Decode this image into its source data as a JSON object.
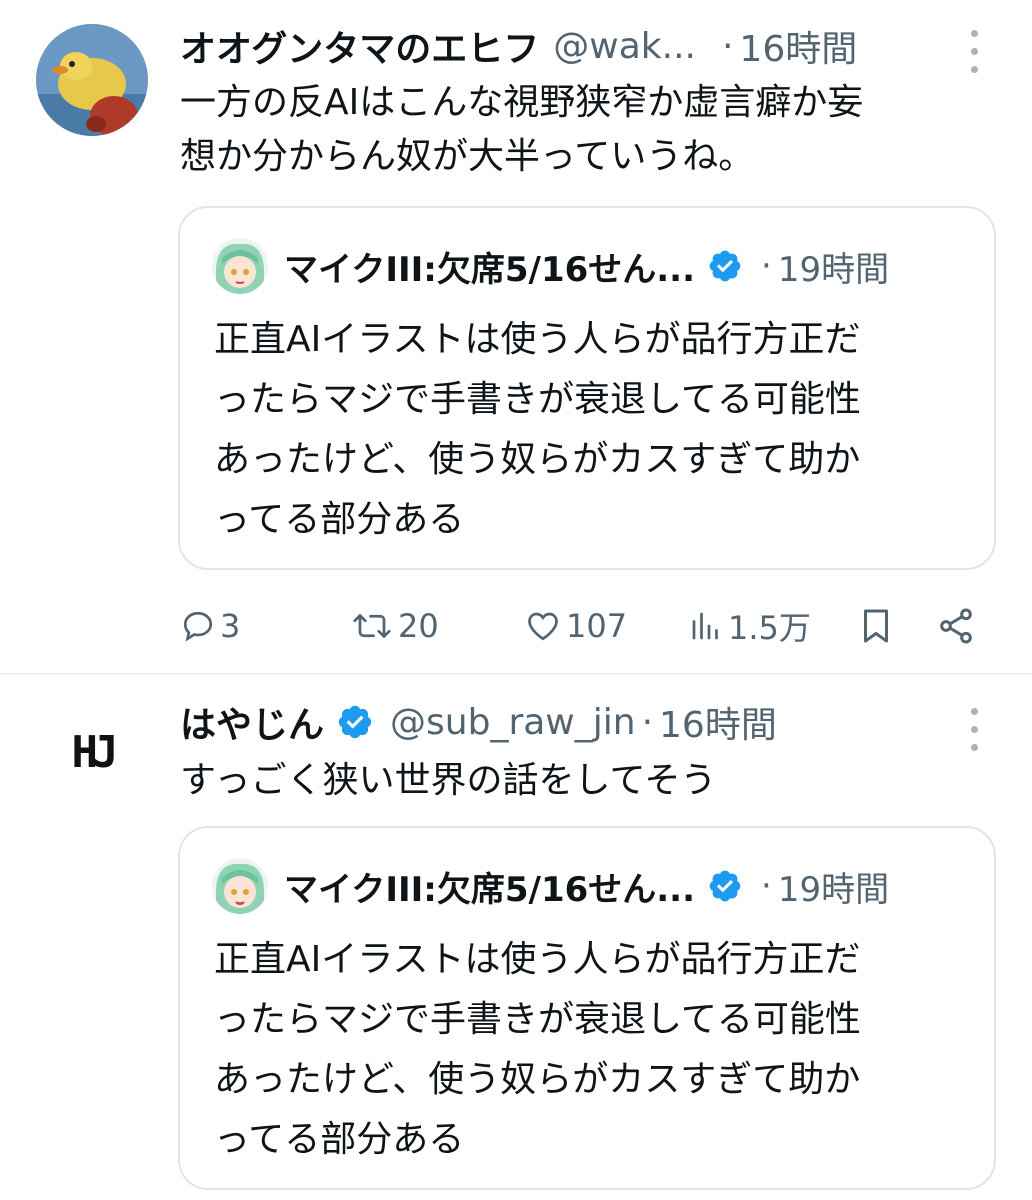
{
  "tweets": [
    {
      "name": "オオグンタマのエヒフ",
      "handle": "@wak...",
      "time": "16時間",
      "text": "一方の反AIはこんな視野狭窄か虚言癖か妄\n想か分からん奴が大半っていうね。",
      "avatar_icon": "chick-plush-avatar",
      "quote": {
        "name": "マイクIII:欠席5/16せん...",
        "time": "19時間",
        "verified": true,
        "text": "正直AIイラストは使う人らが品行方正だ\nったらマジで手書きが衰退してる可能性\nあったけど、使う奴らがカスすぎて助か\nってる部分ある"
      },
      "actions": {
        "reply": "3",
        "retweet": "20",
        "like": "107",
        "views": "1.5万"
      }
    },
    {
      "name": "はやじん",
      "handle": "@sub_raw_jin",
      "time": "16時間",
      "verified": true,
      "avatar_text": "HJ",
      "text": "すっごく狭い世界の話をしてそう",
      "quote": {
        "name": "マイクIII:欠席5/16せん...",
        "time": "19時間",
        "verified": true,
        "text": "正直AIイラストは使う人らが品行方正だ\nったらマジで手書きが衰退してる可能性\nあったけど、使う奴らがカスすぎて助か\nってる部分ある"
      }
    }
  ],
  "colors": {
    "verified": "#1d9bf0",
    "secondary_text": "#536471",
    "border": "#dfe5ea"
  }
}
